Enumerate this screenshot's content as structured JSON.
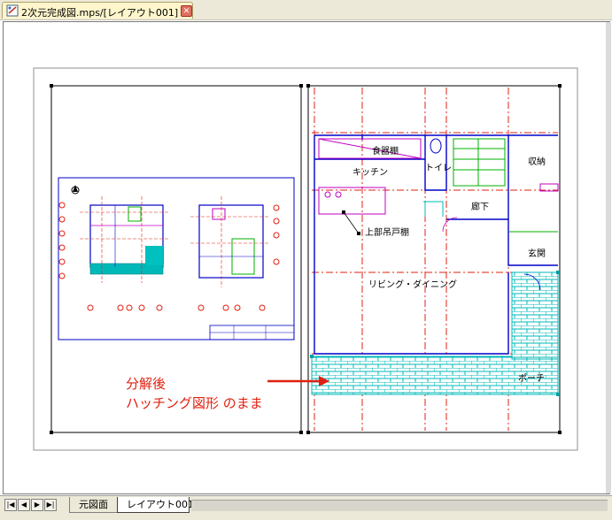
{
  "window": {
    "title": "2次元完成図.mps/[レイアウト001]"
  },
  "tabs": [
    {
      "label": "元図面"
    },
    {
      "label": "レイアウト001"
    }
  ],
  "plan_labels": {
    "shelf": "食器棚",
    "kitchen": "キッチン",
    "toilet": "トイレ",
    "storage": "収納",
    "hallway": "廊下",
    "wall_cupboard": "上部吊戸棚",
    "entrance": "玄関",
    "living": "リビング・ダイニング",
    "porch": "ポーチ"
  },
  "annotation": {
    "line1": "分解後",
    "line2": "ハッチング図形 のまま"
  },
  "colors": {
    "red": "#e02010",
    "blue": "#0000c8",
    "magenta": "#c000c0",
    "green": "#00b000",
    "cyan": "#00c0c0"
  }
}
